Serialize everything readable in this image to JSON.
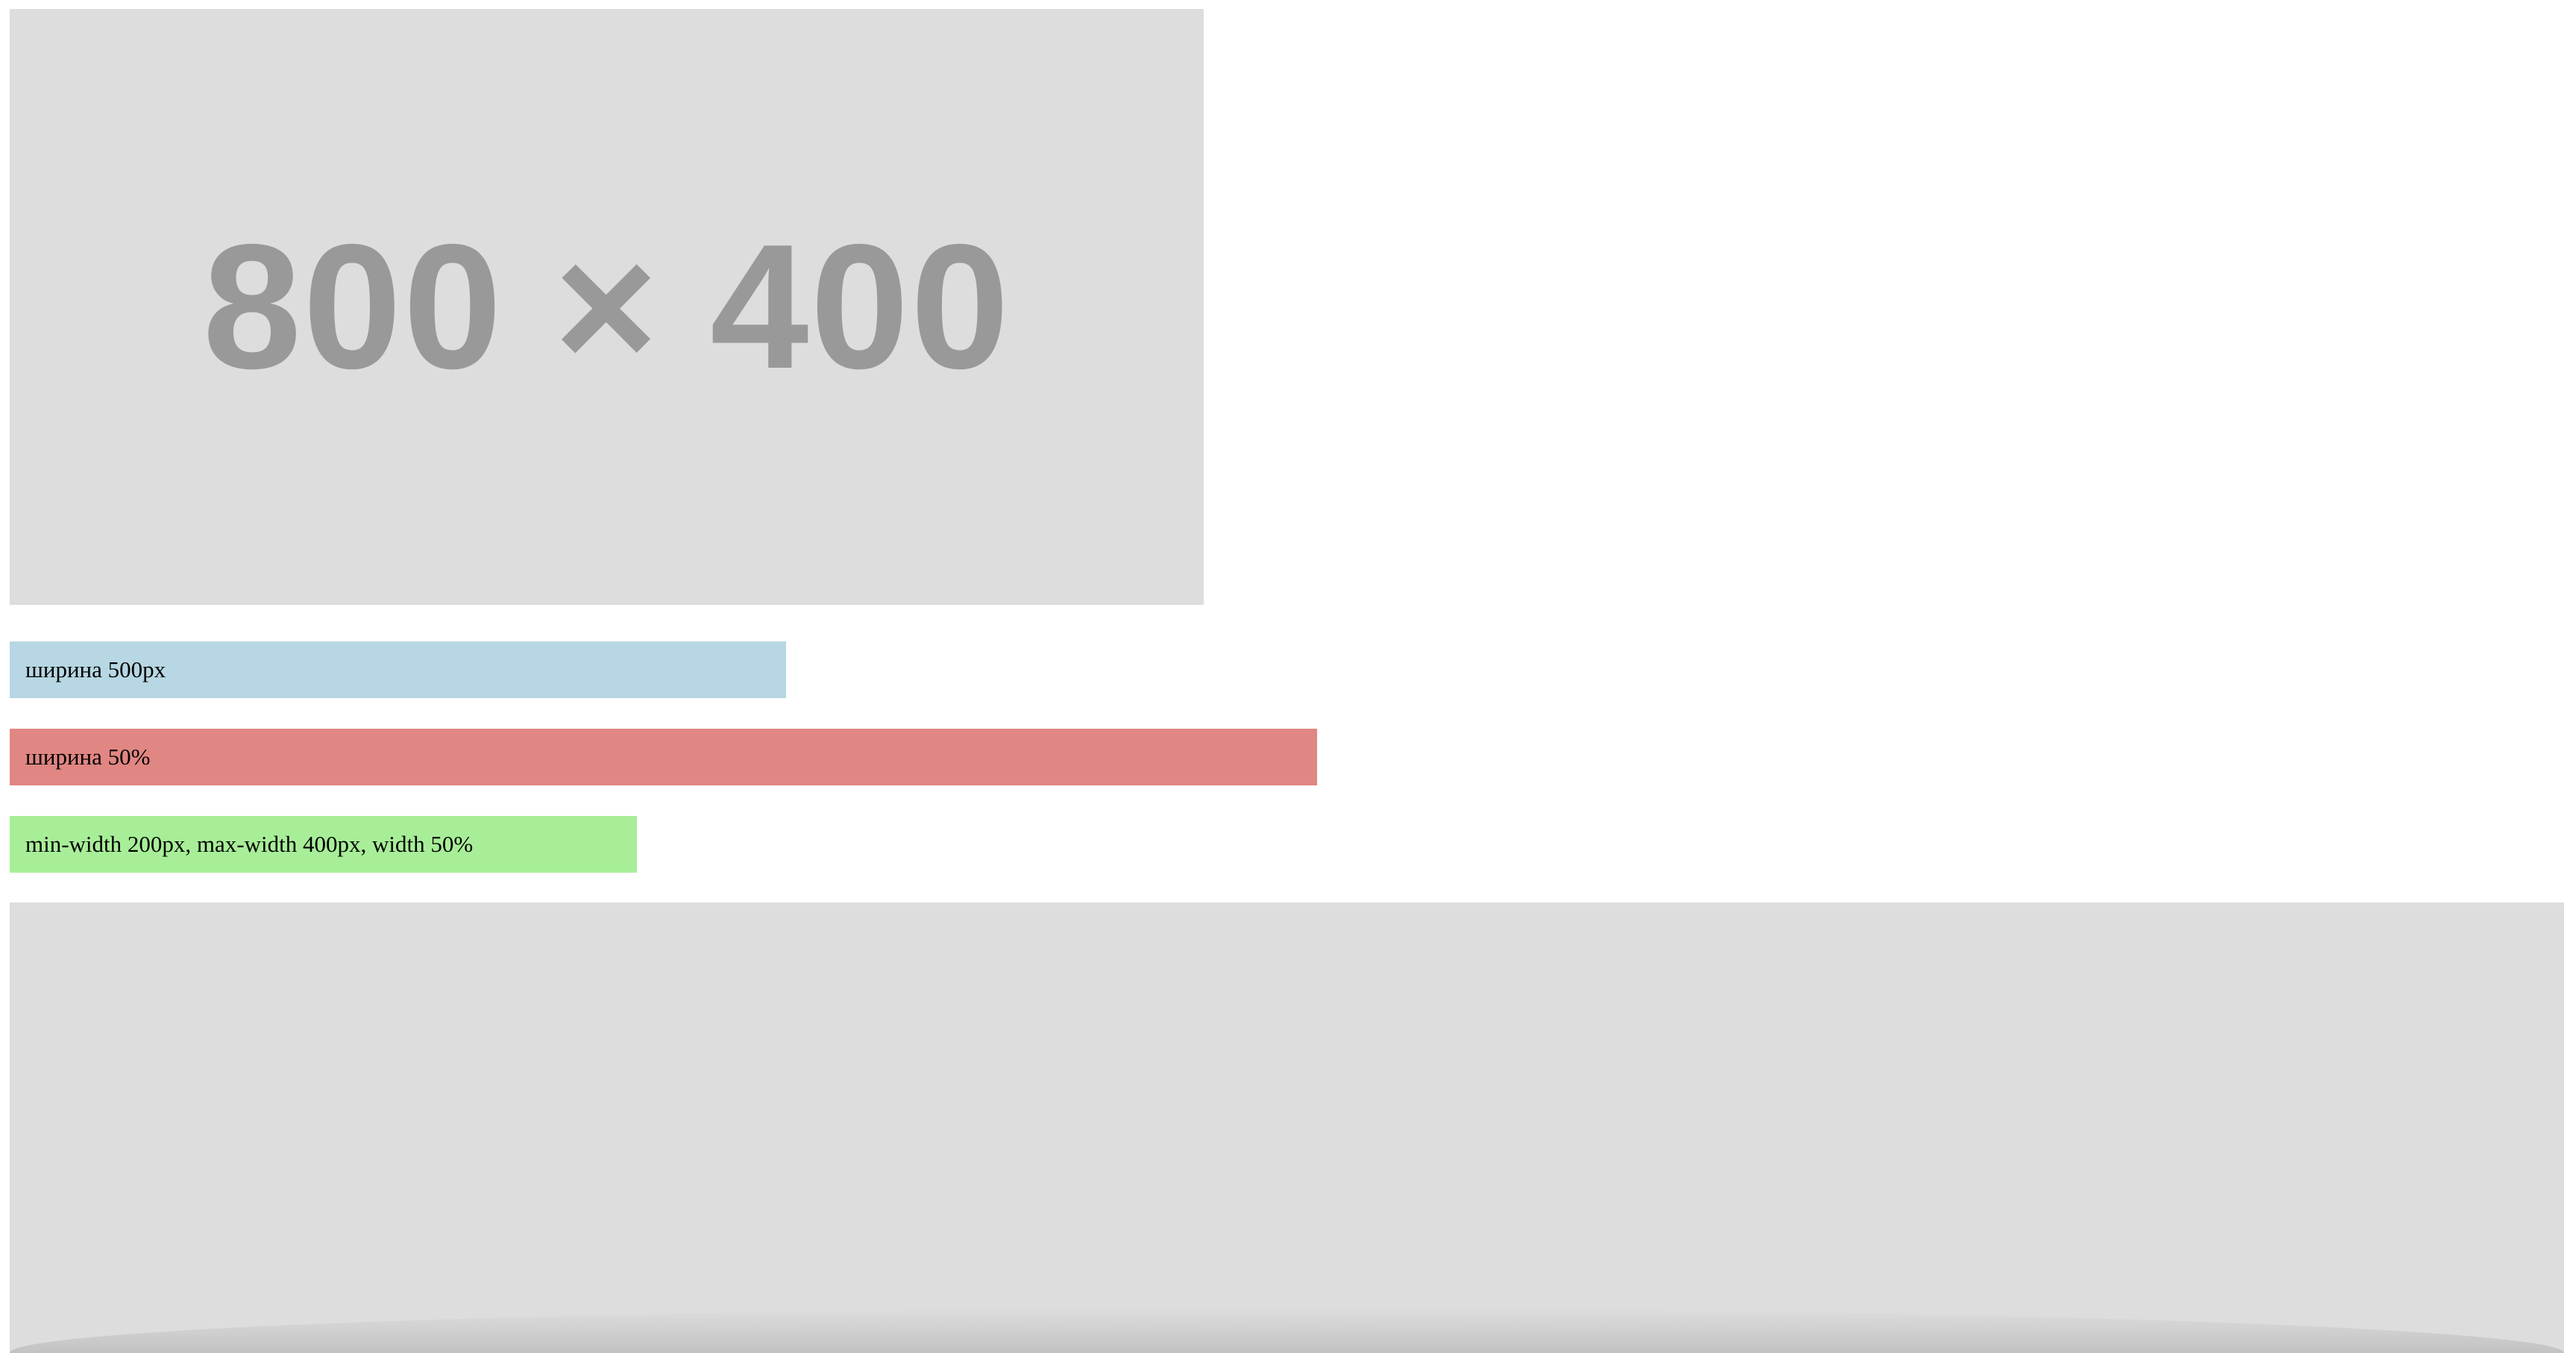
{
  "top_image": {
    "text": "800 × 400"
  },
  "bars": [
    {
      "label": "ширина 500px",
      "color": "#b6d7e3"
    },
    {
      "label": "ширина 50%",
      "color": "#e08683"
    },
    {
      "label": "min-width 200px, max-width 400px, width 50%",
      "color": "#a8ee98"
    }
  ],
  "colors": {
    "placeholder_bg": "#dddddd",
    "placeholder_text": "#999999",
    "page_bg": "#ffffff"
  }
}
